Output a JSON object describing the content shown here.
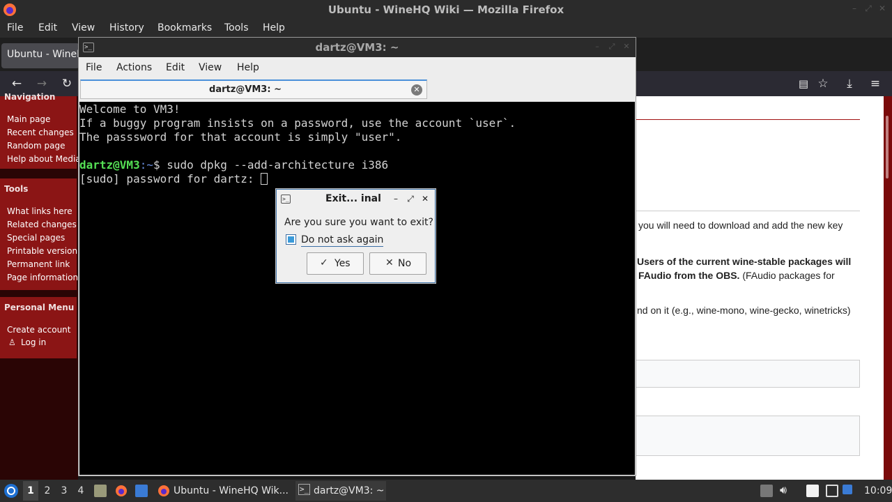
{
  "firefox": {
    "window_title": "Ubuntu - WineHQ Wiki — Mozilla Firefox",
    "menu": [
      "File",
      "Edit",
      "View",
      "History",
      "Bookmarks",
      "Tools",
      "Help"
    ],
    "tab_title": "Ubuntu - WineH"
  },
  "wiki": {
    "sidebar": {
      "navigation_heading": "Navigation",
      "navigation_links": [
        "Main page",
        "Recent changes",
        "Random page",
        "Help about Media"
      ],
      "tools_heading": "Tools",
      "tools_links": [
        "What links here",
        "Related changes",
        "Special pages",
        "Printable version",
        "Permanent link",
        "Page information"
      ],
      "personal_heading": "Personal Menu",
      "personal_links": [
        "Create account",
        "Log in"
      ]
    },
    "content": {
      "line1": "you will need to download and add the new key",
      "line2_bold": "Users of the current wine-stable packages will",
      "line3_bold": "FAudio from the OBS.",
      "line3_rest": " (FAudio packages for",
      "line4": "nd on it (e.g., wine-mono, wine-gecko, winetricks)"
    }
  },
  "terminal": {
    "window_title": "dartz@VM3: ~",
    "menu": [
      "File",
      "Actions",
      "Edit",
      "View",
      "Help"
    ],
    "tab_label": "dartz@VM3: ~",
    "lines": [
      "Welcome to VM3!",
      "If a buggy program insists on a password, use the account `user`.",
      "The passsword for that account is simply \"user\"."
    ],
    "prompt_user": "dartz@VM3",
    "prompt_path": ":~",
    "command": "$ sudo dpkg --add-architecture i386",
    "sudo_prompt": "[sudo] password for dartz: "
  },
  "dialog": {
    "title": "Exit... inal",
    "question": "Are you sure you want to exit?",
    "checkbox_label": "Do not ask again",
    "checkbox_checked": true,
    "yes_label": "Yes",
    "no_label": "No"
  },
  "taskbar": {
    "workspaces": [
      "1",
      "2",
      "3",
      "4"
    ],
    "active_workspace": "1",
    "firefox_task": "Ubuntu - WineHQ Wik...",
    "terminal_task": "dartz@VM3: ~",
    "clock": "10:09"
  },
  "colors": {
    "wiki_sidebar_red": "#8b1515",
    "prompt_green": "#55e055",
    "prompt_blue": "#6a8fe0",
    "dialog_accent": "#3a6ea5"
  }
}
